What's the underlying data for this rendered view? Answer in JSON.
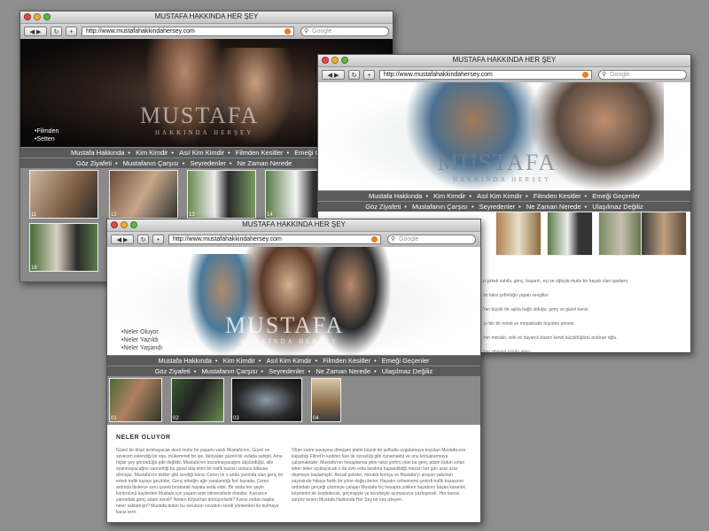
{
  "site": {
    "window_title": "MUSTAFA HAKKINDA HER ŞEY",
    "url": "http://www.mustafahakkindahersey.com",
    "search_placeholder": "Google",
    "logo": "MUSTAFA",
    "logo_sub": "HAKKINDA HERŞEY",
    "nav_row1": [
      "Mustafa Hakkında",
      "Kim Kimdir",
      "Asıl Kim Kimdir",
      "Filmden Kesitler",
      "Emeği Geçenler"
    ],
    "nav_row2": [
      "Göz Ziyafeti",
      "Mustafanın Çarşısı",
      "Seyredenler",
      "Ne Zaman Nerede",
      "Ulaşılmaz Değiliz"
    ],
    "nav_sep": "•"
  },
  "windows": {
    "left": {
      "side_links": [
        "Filmden",
        "Setten"
      ],
      "thumb_numbers": [
        "11",
        "12",
        "13",
        "14",
        "15",
        "16",
        "17"
      ]
    },
    "right": {
      "paragraphs": [
        "...n şirketi sahibi, genç, başarılı, eşi ve oğluyla mutlu bir hayatı olan işadamı.",
        "...'ın taksi şoförlüğü yapan sevgilisi.",
        "...'nın büyük bir aşkla bağlı olduğu, genç ve güzel karısı.",
        "...'yı bin bir emek ve meşakkatle büyüten annesi.",
        "...'nın meraklı, zeki ve dayanılı bazen kendi küçüklüğünü andıran oğlu.",
        "...'nın zihinsel özürlü abisi."
      ]
    },
    "front": {
      "side_links": [
        "Neler Oluyor",
        "Neler Yazıldı",
        "Neler Yaşandı"
      ],
      "thumb_numbers": [
        "01",
        "02",
        "03",
        "04"
      ],
      "section_title": "NELER OLUYOR",
      "col1": "Güzel bir düşü arıtmayacak denli mutlu bir yaşamı vardı Mustafa'nın. Güzel ve sevecen evlendiği bir eşe, mükemmel bir işe, dünyaları güzeli bir evlâda sahipti. Ama hiçbir şey göründüğü gibi değildir. Mustafa'nın bozulmayacağını düşündüğü, aile oyanmayacağını zannettiği bu güzel düş elimi bir trafik kazası sonucu kâbusa dönüşür. Mustafa'nın deliler gibi sevdiği karısı Ceren ve o anda yanında olan genç bir erkek trafik kazası geçirirler. Genç erkeğin ağır yaralandığı feci kazada, Ceren ardında binlerce soru işareti bırakarak hayata veda eder. Bir anda her şeyin kontrolünü kaybeden Mustafa için yaşam artık bilmecelerle doludur. Karısının yanındaki genç adam kimdi? Neden Kilyos'tan dönüyorlardı? Karısı ondan başka neler saklamıştı? Mustafa bütün bu soruların cevabını kendi yöntemleri ile bulmaya karar verir.",
      "col2": "Ölüm kalım savaşına dönüşen platin büyük bir şefkatle uygulamaya koyulan Mustafa eve kapattığı Fikret'in kedinin fare ile oynadığı gibi oynamakta ve onu konuşturmaya çalışmaktadır. Mustafa'nın hesaplarına göre taksi şoförü olan bu genç adam bütün sırları teker teker açıklayacak o da evin erka tarafına hapsedildiği mezarı her gün azar azar deşmeye başlamıştır. Ancak polisler, meraklı komşu ve Mustafa'yı arayan yakınları sayesinde hikaye farklı bir yöne doğru ilerler. Hayatın cehennemi çevirdi trafik kazasının ardındaki gerçeği çözmeye çalışan Mustafa hiç hesapta yokken hayatının başka karanlık köşelerini de keşfedecek, geçmişiyle ve kendisiyle acımasızca yüzleşecek. Her karesi sürpriz kesen Mustafa Hakkında Her Şey bir keş izleyen."
    }
  }
}
